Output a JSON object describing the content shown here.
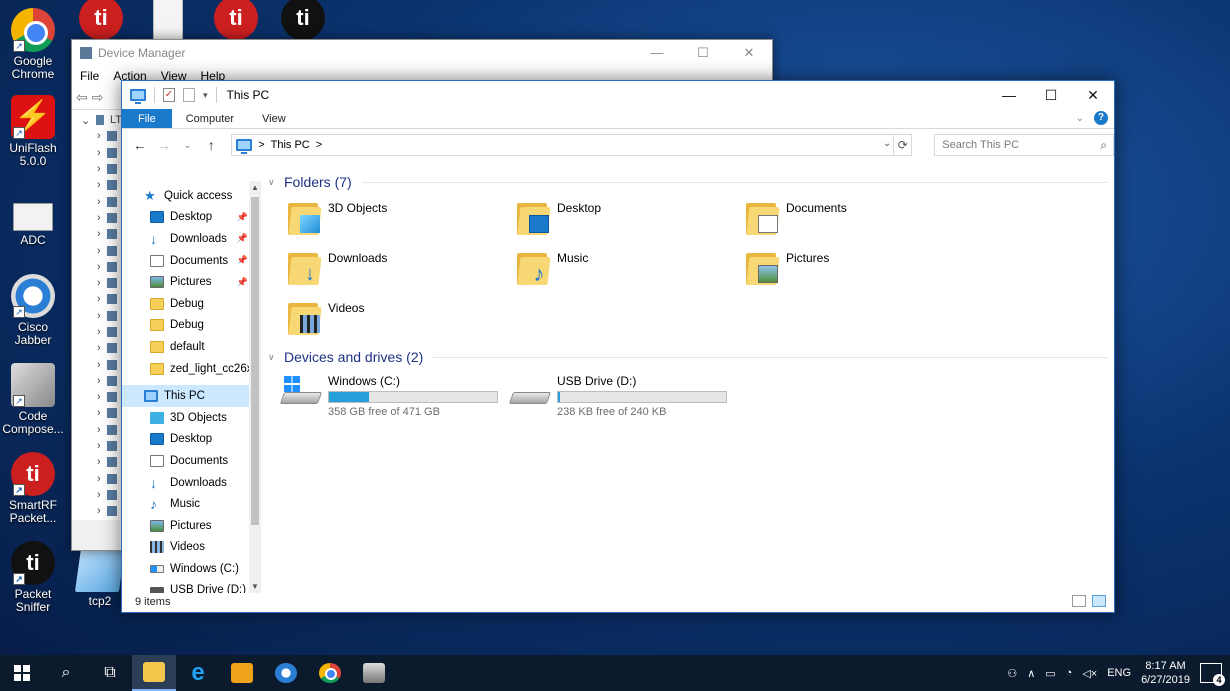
{
  "desktop": {
    "icons": [
      {
        "label": "Google Chrome",
        "icon": "chrome-icon"
      },
      {
        "label": "UniFlash 5.0.0",
        "icon": "uniflash-icon"
      },
      {
        "label": "ADC",
        "icon": "adc-icon"
      },
      {
        "label": "Cisco Jabber",
        "icon": "jabber-icon"
      },
      {
        "label": "Code Compose...",
        "icon": "code-composer-icon"
      },
      {
        "label": "SmartRF Packet...",
        "icon": "smartrf-icon"
      },
      {
        "label": "Packet Sniffer",
        "icon": "packet-sniffer-icon"
      },
      {
        "label": "tcp2",
        "icon": "tcp2-icon"
      }
    ]
  },
  "device_manager": {
    "title": "Device Manager",
    "menu": [
      "File",
      "Action",
      "View",
      "Help"
    ],
    "tree_root": "LT"
  },
  "explorer": {
    "title": "This PC",
    "ribbon_tabs": [
      "File",
      "Computer",
      "View"
    ],
    "address": {
      "crumb": "This PC",
      "separator": ">"
    },
    "search_placeholder": "Search This PC",
    "nav": {
      "quick_access": "Quick access",
      "quick_items": [
        "Desktop",
        "Downloads",
        "Documents",
        "Pictures",
        "Debug",
        "Debug",
        "default",
        "zed_light_cc26x2"
      ],
      "this_pc": "This PC",
      "pc_items": [
        "3D Objects",
        "Desktop",
        "Documents",
        "Downloads",
        "Music",
        "Pictures",
        "Videos",
        "Windows (C:)",
        "USB Drive (D:)"
      ]
    },
    "folders_header": "Folders (7)",
    "folders": [
      "3D Objects",
      "Desktop",
      "Documents",
      "Downloads",
      "Music",
      "Pictures",
      "Videos"
    ],
    "drives_header": "Devices and drives (2)",
    "drives": [
      {
        "name": "Windows (C:)",
        "free": "358 GB free of 471 GB",
        "used_fraction": 0.24
      },
      {
        "name": "USB Drive (D:)",
        "free": "238 KB free of 240 KB",
        "used_fraction": 0.01
      }
    ],
    "status": "9 items"
  },
  "taskbar": {
    "language": "ENG",
    "time": "8:17 AM",
    "date": "6/27/2019",
    "notifications": "4"
  }
}
